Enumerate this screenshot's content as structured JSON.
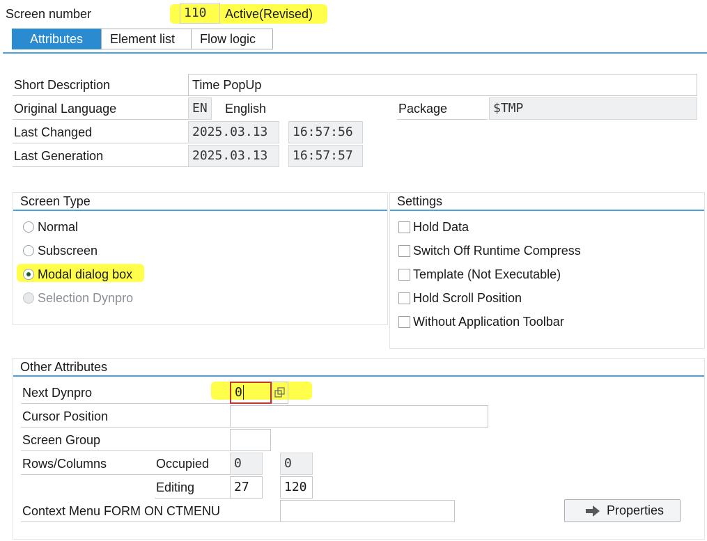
{
  "header": {
    "screen_number_label": "Screen number",
    "screen_number": "110",
    "status": "Active(Revised)"
  },
  "tabs": [
    {
      "label": "Attributes",
      "active": true
    },
    {
      "label": "Element list",
      "active": false
    },
    {
      "label": "Flow logic",
      "active": false
    }
  ],
  "attributes": {
    "short_description_label": "Short Description",
    "short_description": "Time PopUp",
    "original_language_label": "Original Language",
    "language_code": "EN",
    "language_name": "English",
    "package_label": "Package",
    "package": "$TMP",
    "last_changed_label": "Last Changed",
    "last_changed_date": "2025.03.13",
    "last_changed_time": "16:57:56",
    "last_generation_label": "Last Generation",
    "last_generation_date": "2025.03.13",
    "last_generation_time": "16:57:57"
  },
  "screen_type": {
    "title": "Screen Type",
    "options": [
      {
        "label": "Normal",
        "selected": false,
        "disabled": false
      },
      {
        "label": "Subscreen",
        "selected": false,
        "disabled": false
      },
      {
        "label": "Modal dialog box",
        "selected": true,
        "disabled": false
      },
      {
        "label": "Selection Dynpro",
        "selected": false,
        "disabled": true
      }
    ]
  },
  "settings": {
    "title": "Settings",
    "options": [
      {
        "label": "Hold Data",
        "checked": false
      },
      {
        "label": "Switch Off Runtime Compress",
        "checked": false
      },
      {
        "label": "Template (Not Executable)",
        "checked": false
      },
      {
        "label": "Hold Scroll Position",
        "checked": false
      },
      {
        "label": "Without Application Toolbar",
        "checked": false
      }
    ]
  },
  "other_attributes": {
    "title": "Other Attributes",
    "next_dynpro_label": "Next Dynpro",
    "next_dynpro": "0",
    "cursor_position_label": "Cursor Position",
    "cursor_position": "",
    "screen_group_label": "Screen Group",
    "screen_group": "",
    "rows_columns_label": "Rows/Columns",
    "occupied_label": "Occupied",
    "occupied_rows": "0",
    "occupied_cols": "0",
    "editing_label": "Editing",
    "editing_rows": "27",
    "editing_cols": "120",
    "context_menu_label": "Context Menu FORM ON CTMENU",
    "context_menu": "",
    "properties_button": "Properties"
  },
  "highlight_color": "#ffff3c",
  "accent_color": "#2a8bd0"
}
